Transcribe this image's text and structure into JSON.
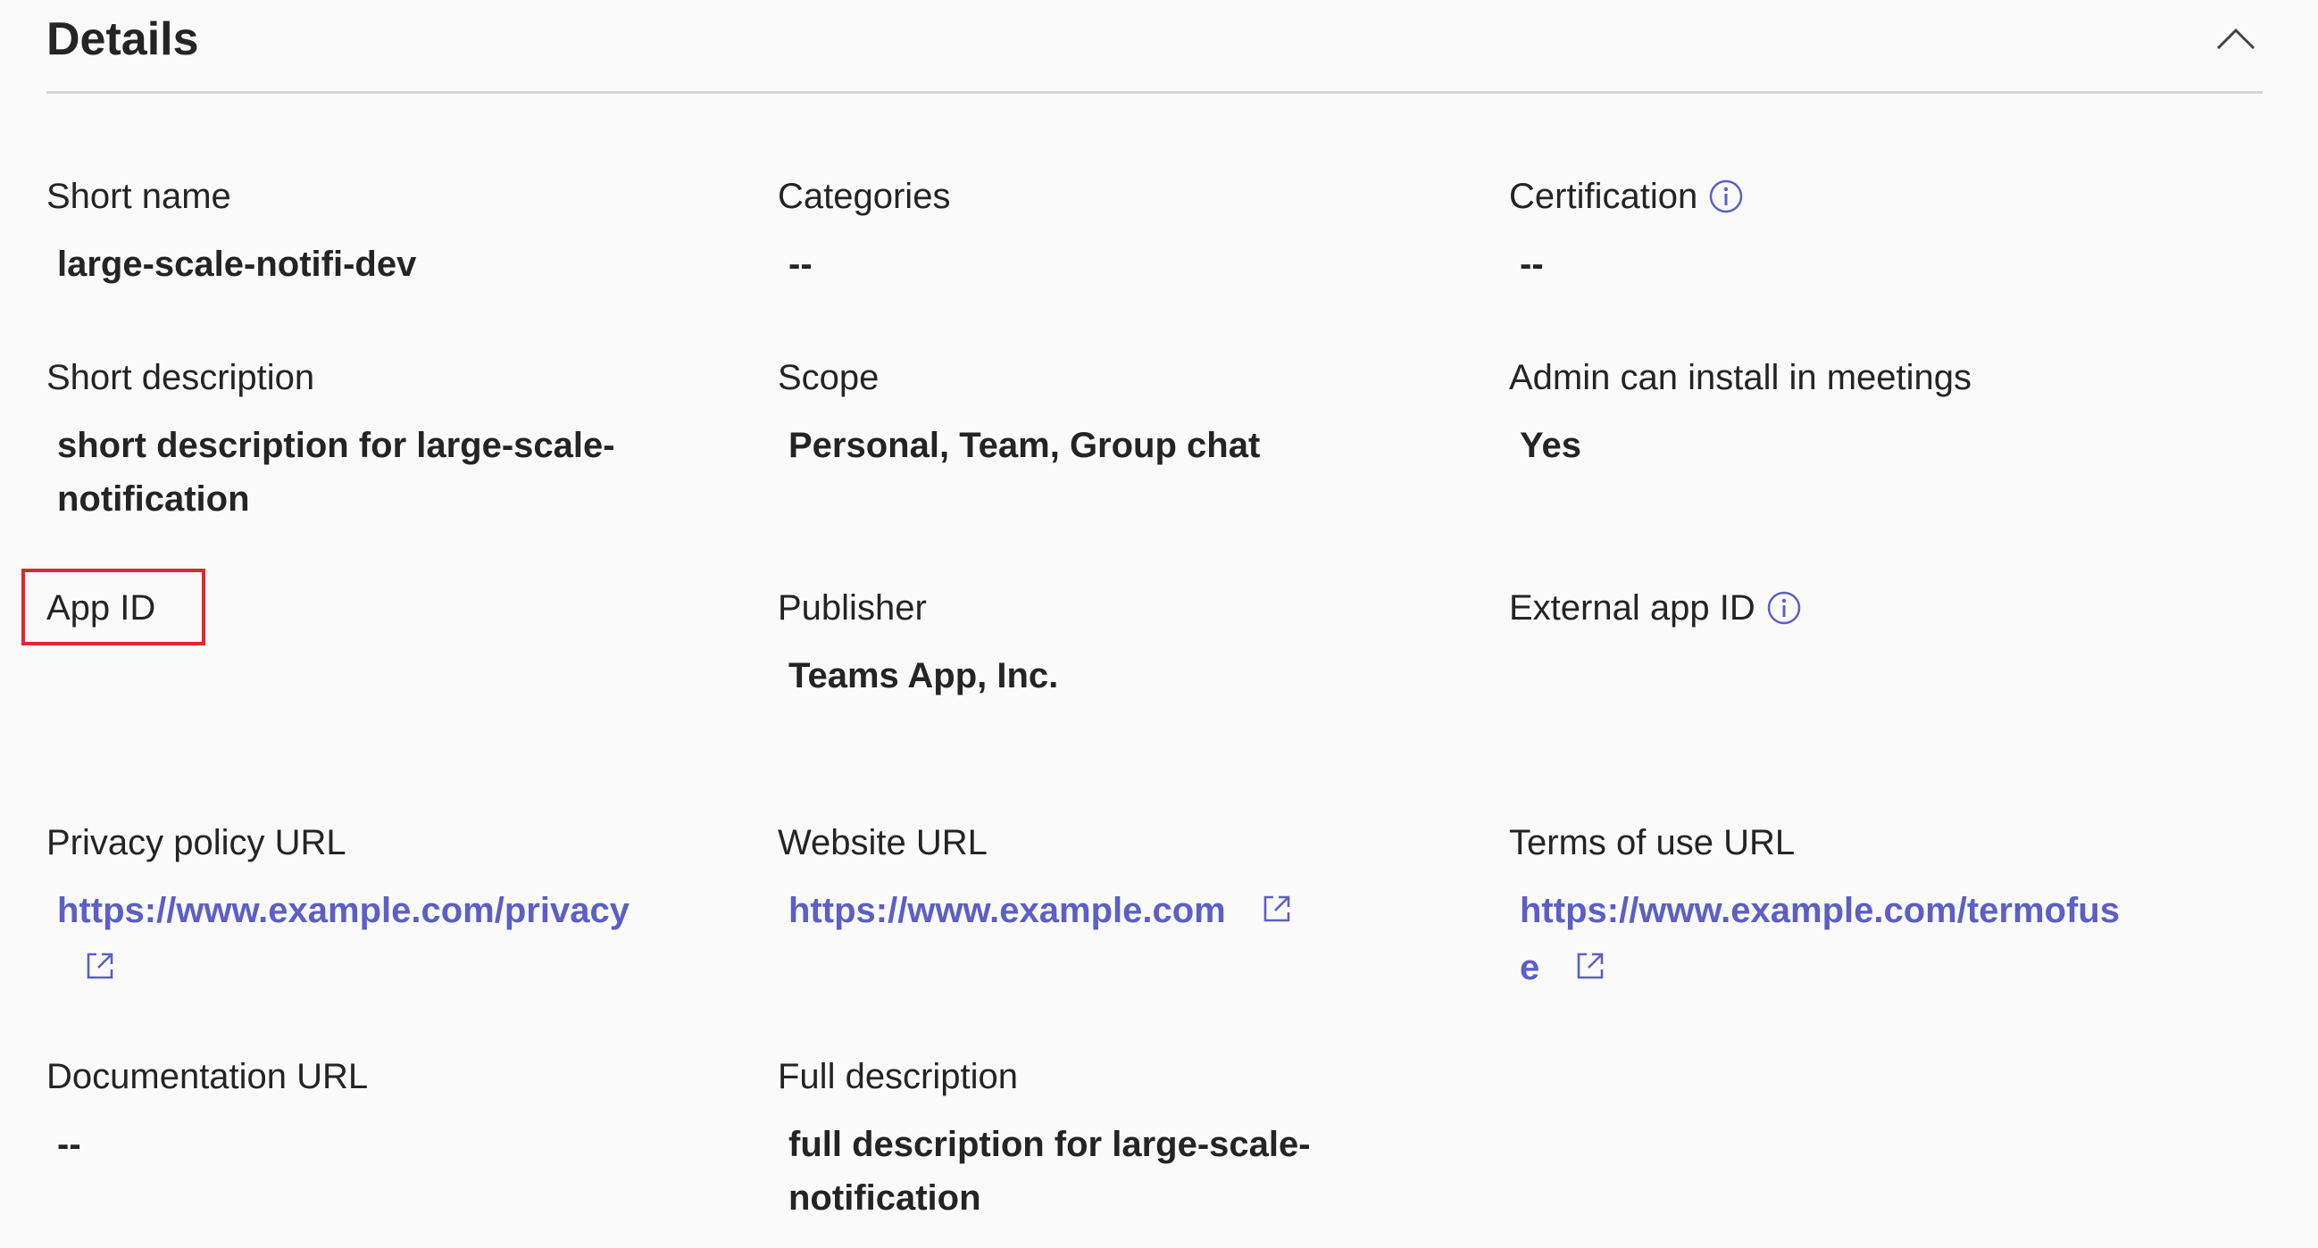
{
  "header": {
    "title": "Details"
  },
  "fields": {
    "short_name": {
      "label": "Short name",
      "value": "large-scale-notifi-dev"
    },
    "categories": {
      "label": "Categories",
      "value": "--"
    },
    "certification": {
      "label": "Certification",
      "value": "--"
    },
    "short_description": {
      "label": "Short description",
      "value": "short description for large-scale-notification"
    },
    "scope": {
      "label": "Scope",
      "value": "Personal, Team, Group chat"
    },
    "admin_install": {
      "label": "Admin can install in meetings",
      "value": "Yes"
    },
    "app_id": {
      "label": "App ID",
      "value": ""
    },
    "publisher": {
      "label": "Publisher",
      "value": "Teams App, Inc."
    },
    "external_app_id": {
      "label": "External app ID",
      "value": ""
    },
    "privacy_url": {
      "label": "Privacy policy URL",
      "value": "https://www.example.com/privacy"
    },
    "website_url": {
      "label": "Website URL",
      "value": "https://www.example.com"
    },
    "terms_url": {
      "label": "Terms of use URL",
      "value": "https://www.example.com/termofuse"
    },
    "documentation_url": {
      "label": "Documentation URL",
      "value": "--"
    },
    "full_description": {
      "label": "Full description",
      "value": "full description for large-scale-notification"
    }
  },
  "colors": {
    "link": "#5b5fc7",
    "highlight": "#e0282e",
    "divider": "#d6d6d6"
  },
  "icons": {
    "collapse": "chevron-up-icon",
    "info": "info-icon",
    "external": "external-link-icon"
  }
}
